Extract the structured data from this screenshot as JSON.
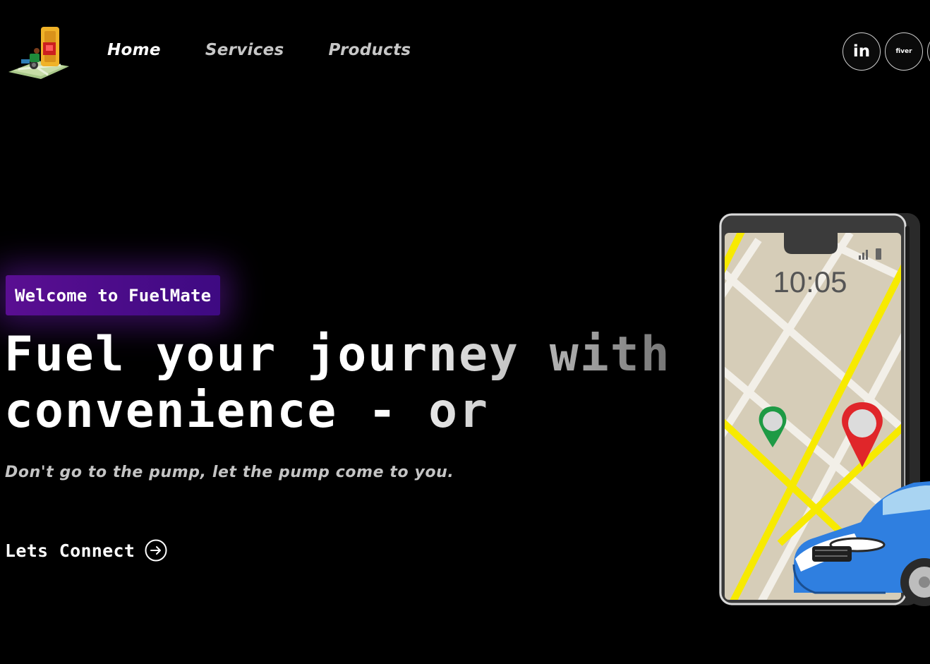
{
  "nav": {
    "items": [
      {
        "label": "Home",
        "active": true
      },
      {
        "label": "Services",
        "active": false
      },
      {
        "label": "Products",
        "active": false
      }
    ]
  },
  "social": {
    "linkedin_label": "in",
    "fiverr_label": "fiver",
    "icons": [
      "linkedin-icon",
      "fiverr-icon",
      "third-social-icon"
    ]
  },
  "hero": {
    "tagline": "Welcome to FuelMate",
    "headline_line1": "Fuel your journey with",
    "headline_line2": "convenience - or",
    "subtitle": "Don't go to the pump, let the pump come to you.",
    "cta_label": "Lets Connect"
  },
  "phone": {
    "clock": "10:05"
  },
  "colors": {
    "background": "#000000",
    "tagline_bg": "#5a0e92",
    "map_road": "#f7ea00",
    "pin_green": "#1e9a45",
    "pin_red": "#e0262a",
    "car_blue": "#2f7fe0"
  }
}
